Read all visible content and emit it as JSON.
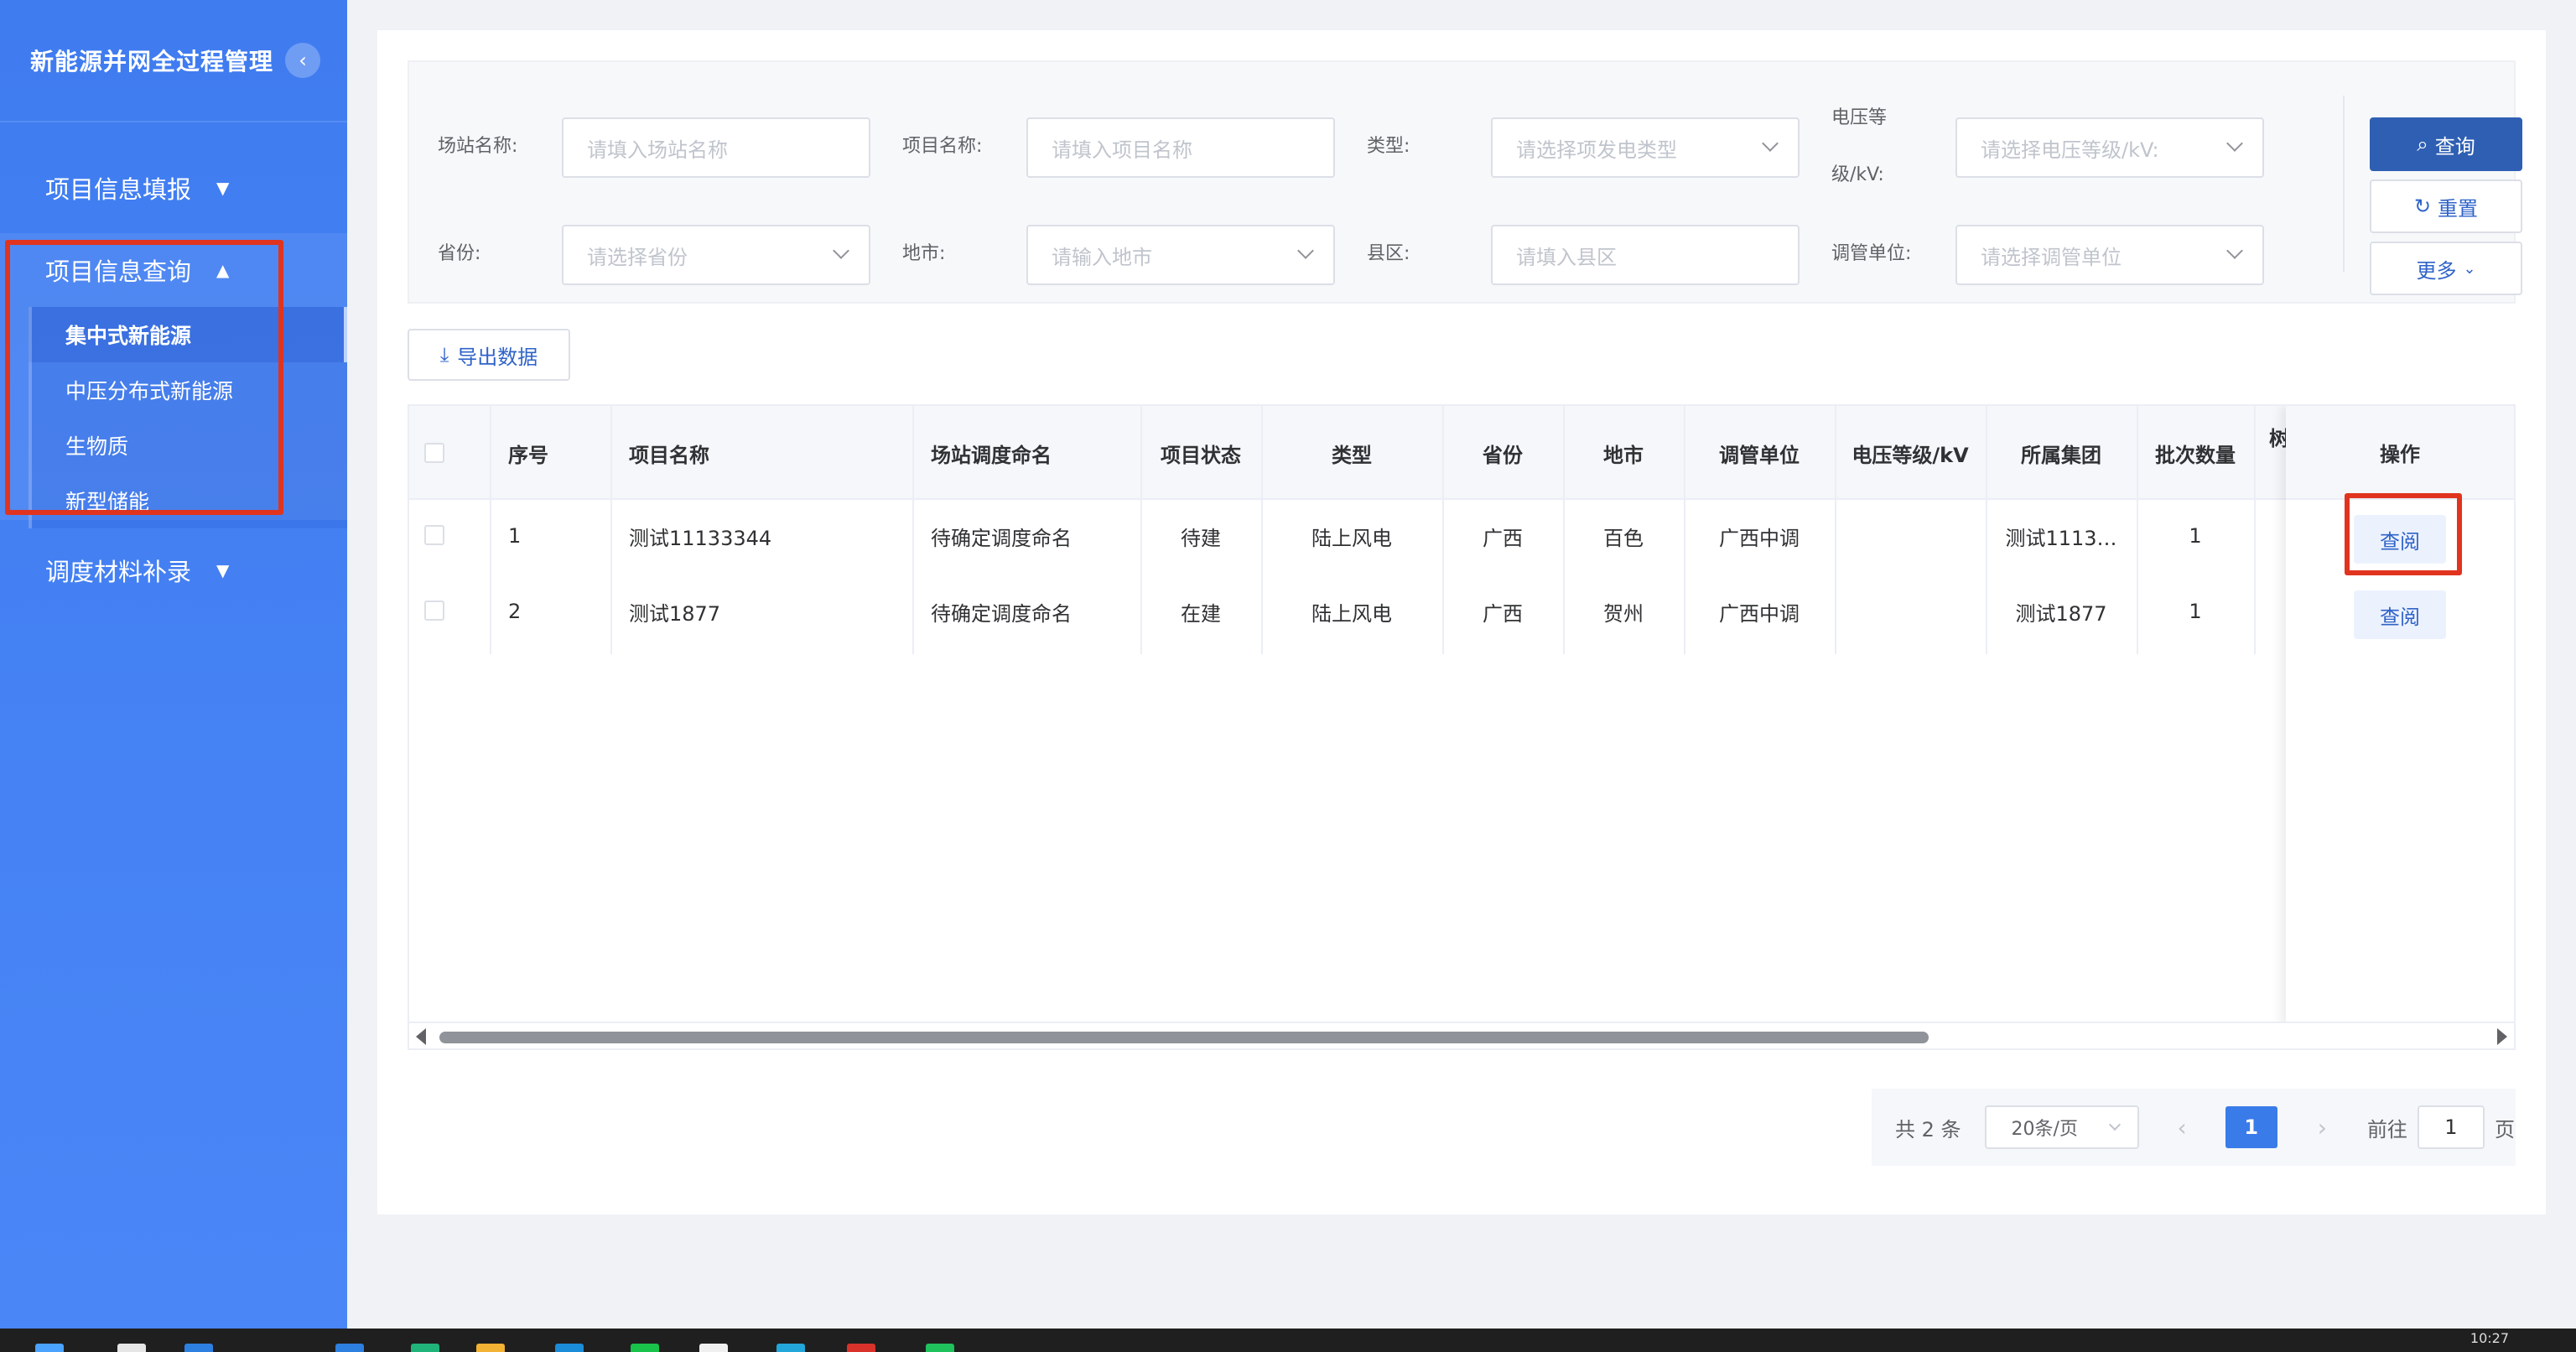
{
  "sidebar": {
    "title": "新能源并网全过程管理",
    "collapse_icon": "‹",
    "menus": [
      {
        "label": "项目信息填报",
        "arrow": "▼"
      },
      {
        "label": "项目信息查询",
        "arrow": "▲"
      },
      {
        "label": "调度材料补录",
        "arrow": "▼"
      }
    ],
    "sub_items": [
      "集中式新能源",
      "中压分布式新能源",
      "生物质",
      "新型储能"
    ]
  },
  "filters": {
    "station_label": "场站名称:",
    "station_placeholder": "请填入场站名称",
    "project_label": "项目名称:",
    "project_placeholder": "请填入项目名称",
    "type_label": "类型:",
    "type_placeholder": "请选择项发电类型",
    "voltage_label_1": "电压等",
    "voltage_label_2": "级/kV:",
    "voltage_placeholder": "请选择电压等级/kV:",
    "province_label": "省份:",
    "province_placeholder": "请选择省份",
    "city_label": "地市:",
    "city_placeholder": "请输入地市",
    "county_label": "县区:",
    "county_placeholder": "请填入县区",
    "dispatch_label": "调管单位:",
    "dispatch_placeholder": "请选择调管单位"
  },
  "buttons": {
    "search": "查询",
    "reset": "重置",
    "more": "更多",
    "export": "导出数据"
  },
  "table": {
    "headers": {
      "index": "序号",
      "project_name": "项目名称",
      "station_name": "场站调度命名",
      "status": "项目状态",
      "type": "类型",
      "province": "省份",
      "city": "地市",
      "dispatch": "调管单位",
      "voltage": "电压等级/kV",
      "group": "所属集团",
      "batch": "批次数量",
      "partial": "树",
      "action": "操作"
    },
    "rows": [
      {
        "index": "1",
        "project_name": "测试11133344",
        "station_name": "待确定调度命名",
        "status": "待建",
        "type": "陆上风电",
        "province": "广西",
        "city": "百色",
        "dispatch": "广西中调",
        "voltage": "",
        "group": "测试1113…",
        "batch": "1",
        "action": "查阅"
      },
      {
        "index": "2",
        "project_name": "测试1877",
        "station_name": "待确定调度命名",
        "status": "在建",
        "type": "陆上风电",
        "province": "广西",
        "city": "贺州",
        "dispatch": "广西中调",
        "voltage": "",
        "group": "测试1877",
        "batch": "1",
        "action": "查阅"
      }
    ]
  },
  "pagination": {
    "total": "共 2 条",
    "page_size": "20条/页",
    "prev": "‹",
    "next": "›",
    "current": "1",
    "goto_label": "前往",
    "goto_value": "1",
    "page_unit": "页"
  },
  "taskbar": {
    "clock": "10:27"
  },
  "colors": {
    "sidebar": "#4a86f6",
    "primary": "#2f5fb3",
    "highlight": "#e0341f"
  }
}
